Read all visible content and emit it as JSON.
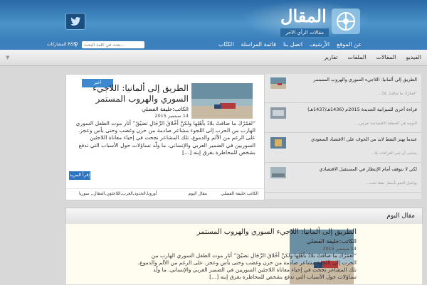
{
  "header": {
    "logo_word": "المقال",
    "logo_tagline": "مقالات الرأي الآخر",
    "twitter_icon": "twitter-icon"
  },
  "topnav": {
    "links": [
      "عن الموقع",
      "الأرشيف",
      "اتصل بنا",
      "قائمة المراسلة",
      "الكتّاب"
    ],
    "search_placeholder": "بحث في كلمة البحث...",
    "rss_label": "المشاركات RSS"
  },
  "catnav": {
    "items": [
      "الفيديو",
      "المقالات",
      "الملفات",
      "تقارير"
    ]
  },
  "featured": {
    "badge": "أخبر",
    "title": "الطريق إلى ألمانيا: اللاجيء السوري والهروب المستمر",
    "author": "الكاتب:خليفة الفضلي",
    "date": "14 سبتمبر 2015",
    "body": "“لعَمْرُكَ ما ضاقتْ بلادٌ بأهْلِها ولكنَّ أخْلاقَ الرِّجَالِ تضيْقُ” أثار موت الطفل السوري الهارب من الحرب إلى اللجوء مشاعر صادمة من حزن وغضب وحتى يأس وعجز. على الرغم من الألم والدموع، تلك المشاعر نجحت في إحياء معاناة اللاجئين السوريين في الضمير العربي والإنساني. ما ولّد تساؤلات حول الأسباب التي تدفع بشخص للمخاطرة بغرق إبنه [...]",
    "read_more": "إقرأ المزيد",
    "footer": {
      "author_link": "الكاتب:خليفة الفضلي",
      "category": "مقال اليوم",
      "tags": "أوروبا,الحدود,العرب,اللاجئون,المقال,, سوريا"
    }
  },
  "sidebar": {
    "items": [
      {
        "title": "الطريق إلى ألمانيا: اللاجيء السوري والهروب المستمر",
        "meta": "“لعَمْرُكَ ما ضاقتْ بلادٌ..."
      },
      {
        "title": "قراءة أخرى للميزانية الجديدة 2015م (1436هـ/1437هـ)",
        "meta": "التوجه في الخطط الاقتصادية تفرض..."
      },
      {
        "title": "عندما يهتز النفط لابد من الخوف على الاقتصاد السعودي",
        "meta": "يخشى أن تمر القراءات بلا..."
      },
      {
        "title": "لكي لا نتوقف أمام الإنتظار في المستقبل الاقتصادي",
        "meta": "يواصل النمو بأسعار نفط تحت..."
      }
    ]
  },
  "daily": {
    "header": "مقال اليوم",
    "title": "الطريق إلى ألمانيا: اللاجيء السوري والهروب المستمر",
    "author": "الكاتب:خليفة الفضلي",
    "date": "14 سبتمبر 2015",
    "body": "“لعَمْرُكَ ما ضاقتْ بلادٌ بأهْلِها ولكنَّ أخْلاقَ الرِّجَالِ تضيْقُ” أثار موت الطفل السوري الهارب من الحرب إلى اللجوء مشاعر صادمة من حزن وغضب وحتى يأس وعجز. على الرغم من الألم والدموع، تلك المشاعر نجحت في إحياء معاناة اللاجئين السوريين في الضمير العربي والإنساني. ما ولّد تساؤلات حول الأسباب التي تدفع بشخص للمخاطرة بغرق إبنه [...]"
  },
  "colors": {
    "header_blue": "#3f86c4",
    "accent_blue": "#2d73bd",
    "daily_bg": "#fffdf0"
  }
}
